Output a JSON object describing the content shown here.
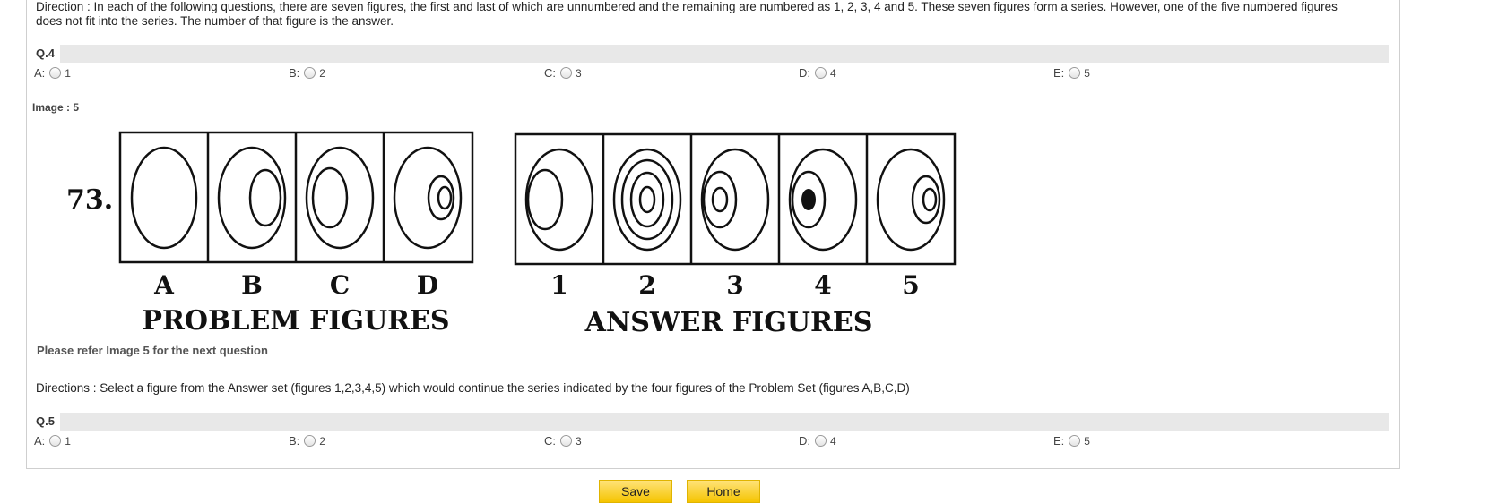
{
  "direction_text": "Direction : In each of the following questions, there are seven figures, the first and last of which are unnumbered and the remaining are numbered as 1, 2, 3, 4 and 5. These seven figures form a series. However, one of the five numbered figures does not fit into the series. The number of that figure is the answer.",
  "q4": {
    "label": "Q.4",
    "options": [
      {
        "letter": "A:",
        "value": "1"
      },
      {
        "letter": "B:",
        "value": "2"
      },
      {
        "letter": "C:",
        "value": "3"
      },
      {
        "letter": "D:",
        "value": "4"
      },
      {
        "letter": "E:",
        "value": "5"
      }
    ]
  },
  "image_label": "Image : 5",
  "figure": {
    "question_number": "73.",
    "problem_letters": [
      "A",
      "B",
      "C",
      "D"
    ],
    "answer_numbers": [
      "1",
      "2",
      "3",
      "4",
      "5"
    ],
    "problem_caption": "PROBLEM FIGURES",
    "answer_caption": "ANSWER FIGURES"
  },
  "refer_text": "Please refer Image 5 for the next question",
  "directions2": "Directions : Select a figure from the Answer set (figures 1,2,3,4,5) which would continue the series indicated by the four figures of the Problem Set (figures A,B,C,D)",
  "q5": {
    "label": "Q.5",
    "options": [
      {
        "letter": "A:",
        "value": "1"
      },
      {
        "letter": "B:",
        "value": "2"
      },
      {
        "letter": "C:",
        "value": "3"
      },
      {
        "letter": "D:",
        "value": "4"
      },
      {
        "letter": "E:",
        "value": "5"
      }
    ]
  },
  "buttons": {
    "save": "Save",
    "home": "Home"
  },
  "colors": {
    "button_bg": "#f5c400",
    "question_bar": "#e8e8e8"
  }
}
